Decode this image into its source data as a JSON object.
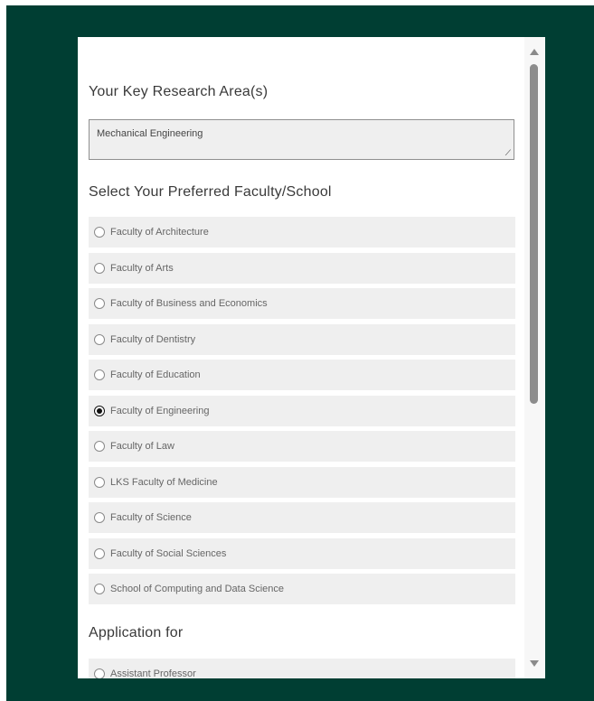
{
  "research": {
    "title": "Your Key Research Area(s)",
    "value": "Mechanical Engineering",
    "resize_glyph": "⟋"
  },
  "faculty": {
    "title": "Select Your Preferred Faculty/School",
    "selected": "Faculty of Engineering",
    "options": [
      "Faculty of Architecture",
      "Faculty of Arts",
      "Faculty of Business and Economics",
      "Faculty of Dentistry",
      "Faculty of Education",
      "Faculty of Engineering",
      "Faculty of Law",
      "LKS Faculty of Medicine",
      "Faculty of Science",
      "Faculty of Social Sciences",
      "School of Computing and Data Science"
    ]
  },
  "application": {
    "title": "Application for",
    "options": [
      "Assistant Professor"
    ]
  },
  "colors": {
    "frame_bg": "#003e33",
    "option_bg": "#efefef"
  }
}
